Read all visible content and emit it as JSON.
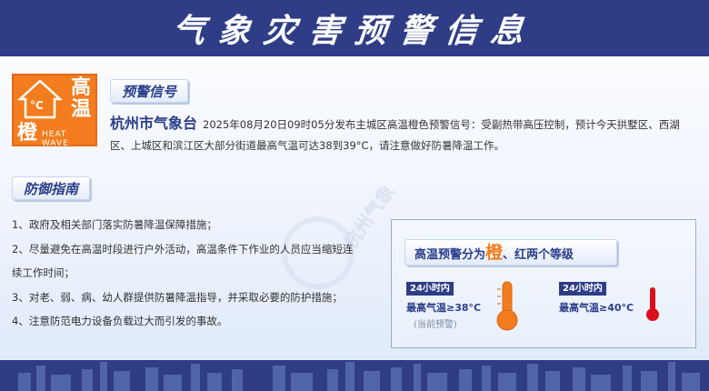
{
  "banner": {
    "title": "气象灾害预警信息"
  },
  "signal_icon": {
    "unit": "°C",
    "char_top": "高",
    "char_bottom": "温",
    "level_char": "橙",
    "english": "HEAT WAVE",
    "color": "#f37d1e"
  },
  "section_signal": {
    "label": "预警信号"
  },
  "warning": {
    "issuer": "杭州市气象台",
    "text": "2025年08月20日09时05分发布主城区高温橙色预警信号：受副热带高压控制，预计今天拱墅区、西湖区、上城区和滨江区大部分街道最高气温可达38到39°C，请注意做好防暑降温工作。"
  },
  "section_guide": {
    "label": "防御指南"
  },
  "guide_items": [
    "1、政府及相关部门落实防暑降温保障措施；",
    "2、尽量避免在高温时段进行户外活动，高温条件下作业的人员应当缩短连",
    "续工作时间；",
    "3、对老、弱、病、幼人群提供防暑降温指导，并采取必要的防护措施；",
    "4、注意防范电力设备负载过大而引发的事故。"
  ],
  "watermark": {
    "text": "杭州气象"
  },
  "levels_panel": {
    "title_prefix": "高温预警分为",
    "title_em": "橙",
    "title_suffix": "、红两个等级",
    "orange": {
      "tag": "24小时内",
      "condition": "最高气温≥38°C",
      "note": "(当前预警)",
      "color": "#f37d1e"
    },
    "red": {
      "tag": "24小时内",
      "condition": "最高气温≥40°C",
      "color": "#d9101c"
    }
  },
  "colors": {
    "banner": "#2e3d86",
    "accent": "#2a3e8a",
    "orange": "#f37d1e",
    "red": "#d9101c"
  }
}
